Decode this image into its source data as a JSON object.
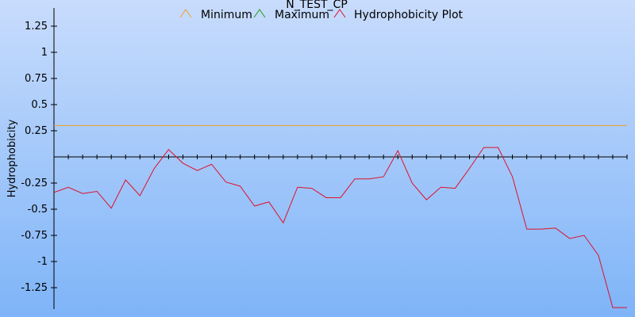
{
  "chart_data": {
    "type": "line",
    "title": "N_TEST_CP",
    "ylabel": "Hydrophobicity",
    "xlabel": "",
    "ylim": [
      -1.44,
      1.42
    ],
    "yticks": [
      {
        "value": 1.25,
        "label": "1.25"
      },
      {
        "value": 1,
        "label": "1"
      },
      {
        "value": 0.75,
        "label": "0.75"
      },
      {
        "value": 0.5,
        "label": "0.5"
      },
      {
        "value": 0.25,
        "label": "0.25"
      },
      {
        "value": -0.25,
        "label": "-0.25"
      },
      {
        "value": -0.5,
        "label": "-0.5"
      },
      {
        "value": -0.75,
        "label": "-0.75"
      },
      {
        "value": -1,
        "label": "-1"
      },
      {
        "value": -1.25,
        "label": "-1.25"
      }
    ],
    "x": [
      0,
      1,
      2,
      3,
      4,
      5,
      6,
      7,
      8,
      9,
      10,
      11,
      12,
      13,
      14,
      15,
      16,
      17,
      18,
      19,
      20,
      21,
      22,
      23,
      24,
      25,
      26,
      27,
      28,
      29,
      30,
      31,
      32,
      33,
      34,
      35,
      36,
      37,
      38,
      39,
      40
    ],
    "legend_position": "top-center",
    "series": [
      {
        "name": "Minimum",
        "color": "#f0a020",
        "values": [
          0.3,
          0.3,
          0.3,
          0.3,
          0.3,
          0.3,
          0.3,
          0.3,
          0.3,
          0.3,
          0.3,
          0.3,
          0.3,
          0.3,
          0.3,
          0.3,
          0.3,
          0.3,
          0.3,
          0.3,
          0.3,
          0.3,
          0.3,
          0.3,
          0.3,
          0.3,
          0.3,
          0.3,
          0.3,
          0.3,
          0.3,
          0.3,
          0.3,
          0.3,
          0.3,
          0.3,
          0.3,
          0.3,
          0.3,
          0.3,
          0.3
        ]
      },
      {
        "name": "Maximum",
        "color": "#1a9a1a",
        "values": []
      },
      {
        "name": "Hydrophobicity Plot",
        "color": "#e0102a",
        "values": [
          -0.34,
          -0.29,
          -0.35,
          -0.33,
          -0.49,
          -0.22,
          -0.37,
          -0.11,
          0.07,
          -0.06,
          -0.13,
          -0.07,
          -0.24,
          -0.28,
          -0.47,
          -0.43,
          -0.63,
          -0.29,
          -0.3,
          -0.39,
          -0.39,
          -0.21,
          -0.21,
          -0.19,
          0.06,
          -0.25,
          -0.41,
          -0.29,
          -0.3,
          -0.11,
          0.09,
          0.09,
          -0.19,
          -0.69,
          -0.69,
          -0.68,
          -0.78,
          -0.75,
          -0.94,
          -1.44,
          -1.44
        ]
      }
    ]
  }
}
